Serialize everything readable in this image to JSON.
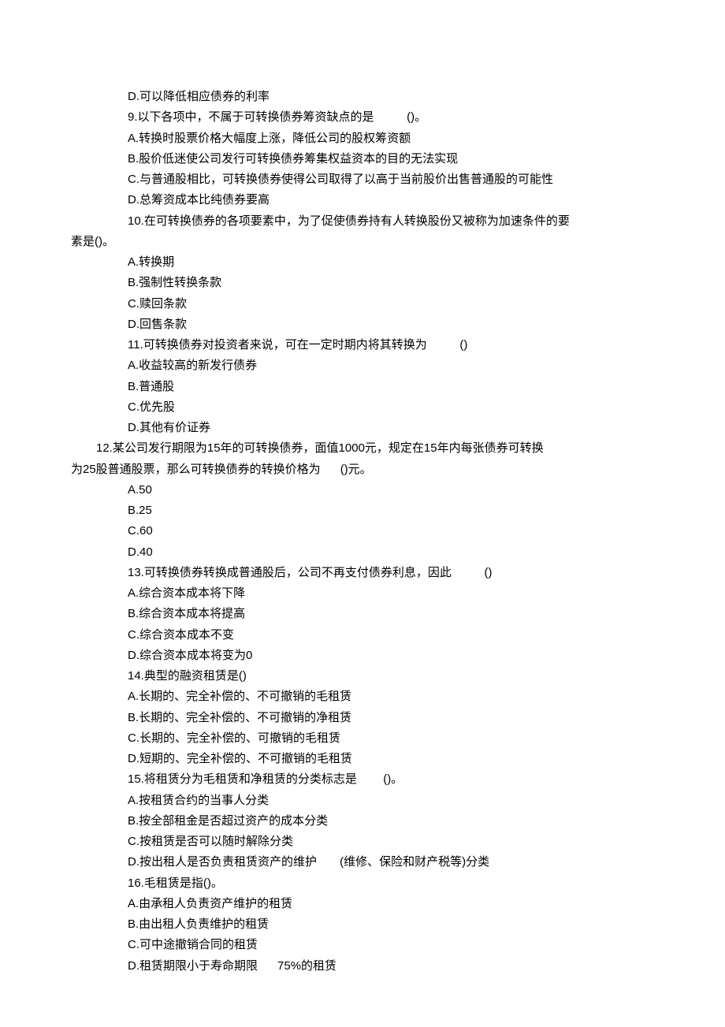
{
  "lines": [
    {
      "cls": "indent-1",
      "text": "D.可以降低相应债券的利率"
    },
    {
      "cls": "indent-1",
      "text": "9.以下各项中，不属于可转换债券筹资缺点的是          ()。"
    },
    {
      "cls": "indent-1",
      "text": "A.转换时股票价格大幅度上涨，降低公司的股权筹资额"
    },
    {
      "cls": "indent-1",
      "text": "B.股价低迷使公司发行可转换债券筹集权益资本的目的无法实现"
    },
    {
      "cls": "indent-1",
      "text": "C.与普通股相比，可转换债券使得公司取得了以高于当前股价出售普通股的可能性"
    },
    {
      "cls": "indent-1",
      "text": "D.总筹资成本比纯债券要高"
    },
    {
      "cls": "indent-1",
      "text": "10.在可转换债券的各项要素中，为了促使债券持有人转换股份又被称为加速条件的要"
    },
    {
      "cls": "indent-wrap",
      "text": "素是()。"
    },
    {
      "cls": "indent-1",
      "text": "A.转换期"
    },
    {
      "cls": "indent-1",
      "text": "B.强制性转换条款"
    },
    {
      "cls": "indent-1",
      "text": "C.赎回条款"
    },
    {
      "cls": "indent-1",
      "text": "D.回售条款"
    },
    {
      "cls": "indent-1",
      "text": "11.可转换债券对投资者来说，可在一定时期内将其转换为          ()"
    },
    {
      "cls": "indent-1",
      "text": "A.收益较高的新发行债券"
    },
    {
      "cls": "indent-1",
      "text": "B.普通股"
    },
    {
      "cls": "indent-1",
      "text": "C.优先股"
    },
    {
      "cls": "indent-1",
      "text": "D.其他有价证券"
    },
    {
      "cls": "indent-2",
      "text": "12.某公司发行期限为15年的可转换债券，面值1000元，规定在15年内每张债券可转换"
    },
    {
      "cls": "indent-wrap",
      "text": "为25股普通股票，那么可转换债券的转换价格为      ()元。"
    },
    {
      "cls": "indent-1",
      "text": "A.50"
    },
    {
      "cls": "indent-1",
      "text": "B.25"
    },
    {
      "cls": "indent-1",
      "text": "C.60"
    },
    {
      "cls": "indent-1",
      "text": "D.40"
    },
    {
      "cls": "indent-1",
      "text": "13.可转换债券转换成普通股后，公司不再支付债券利息，因此          ()"
    },
    {
      "cls": "indent-1",
      "text": "A.综合资本成本将下降"
    },
    {
      "cls": "indent-1",
      "text": "B.综合资本成本将提高"
    },
    {
      "cls": "indent-1",
      "text": "C.综合资本成本不变"
    },
    {
      "cls": "indent-1",
      "text": "D.综合资本成本将变为0"
    },
    {
      "cls": "indent-1",
      "text": "14.典型的融资租赁是()"
    },
    {
      "cls": "indent-1",
      "text": "A.长期的、完全补偿的、不可撤销的毛租赁"
    },
    {
      "cls": "indent-1",
      "text": "B.长期的、完全补偿的、不可撤销的净租赁"
    },
    {
      "cls": "indent-1",
      "text": "C.长期的、完全补偿的、可撤销的毛租赁"
    },
    {
      "cls": "indent-1",
      "text": "D.短期的、完全补偿的、不可撤销的毛租赁"
    },
    {
      "cls": "indent-1",
      "text": "15.将租赁分为毛租赁和净租赁的分类标志是        ()。"
    },
    {
      "cls": "indent-1",
      "text": "A.按租赁合约的当事人分类"
    },
    {
      "cls": "indent-1",
      "text": "B.按全部租金是否超过资产的成本分类"
    },
    {
      "cls": "indent-1",
      "text": "C.按租赁是否可以随时解除分类"
    },
    {
      "cls": "indent-1",
      "text": "D.按出租人是否负责租赁资产的维护       (维修、保险和财产税等)分类"
    },
    {
      "cls": "indent-1",
      "text": "16.毛租赁是指()。"
    },
    {
      "cls": "indent-1",
      "text": "A.由承租人负责资产维护的租赁"
    },
    {
      "cls": "indent-1",
      "text": "B.由出租人负责维护的租赁"
    },
    {
      "cls": "indent-1",
      "text": "C.可中途撤销合同的租赁"
    },
    {
      "cls": "indent-1",
      "text": "D.租赁期限小于寿命期限      75%的租赁"
    }
  ]
}
